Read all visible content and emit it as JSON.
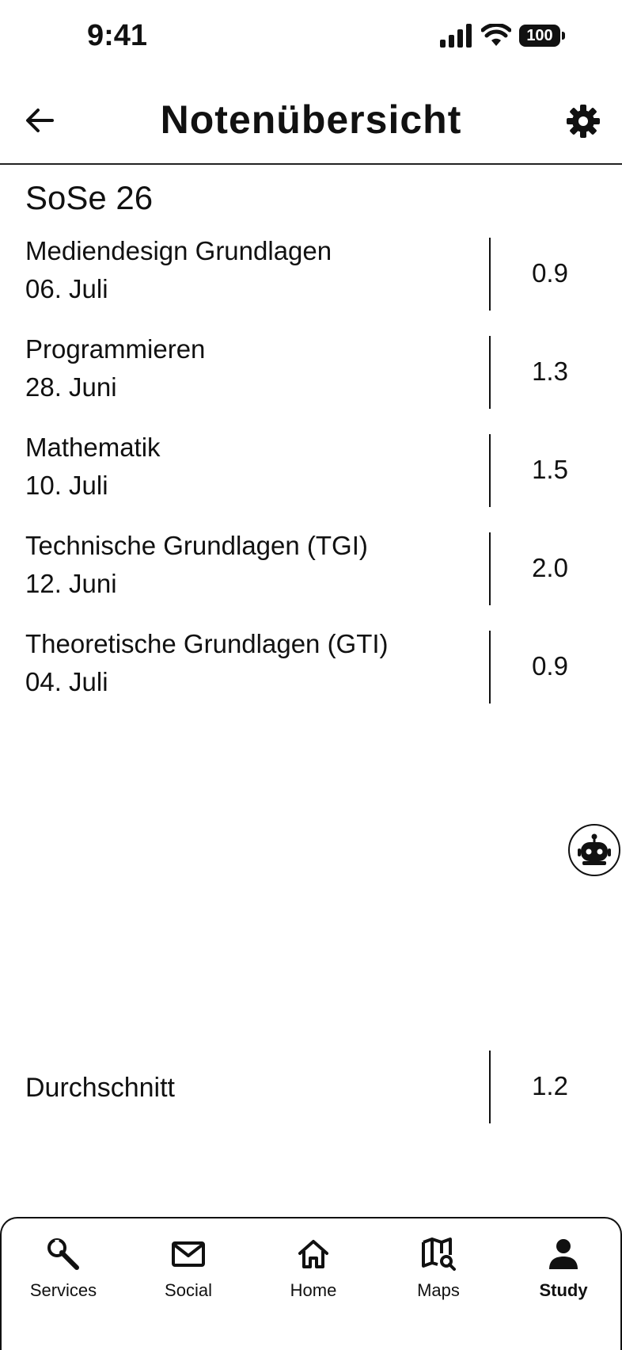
{
  "status_bar": {
    "time": "9:41",
    "battery": "100"
  },
  "header": {
    "title": "Notenübersicht"
  },
  "semester": "SoSe 26",
  "courses": [
    {
      "name": "Mediendesign Grundlagen",
      "date": "06. Juli",
      "grade": "0.9"
    },
    {
      "name": "Programmieren",
      "date": "28. Juni",
      "grade": "1.3"
    },
    {
      "name": "Mathematik",
      "date": "10. Juli",
      "grade": "1.5"
    },
    {
      "name": "Technische Grundlagen (TGI)",
      "date": "12. Juni",
      "grade": "2.0"
    },
    {
      "name": "Theoretische Grundlagen (GTI)",
      "date": "04. Juli",
      "grade": "0.9"
    }
  ],
  "average": {
    "label": "Durchschnitt",
    "value": "1.2"
  },
  "tabs": [
    {
      "label": "Services",
      "icon": "wrench-icon"
    },
    {
      "label": "Social",
      "icon": "mail-icon"
    },
    {
      "label": "Home",
      "icon": "home-icon"
    },
    {
      "label": "Maps",
      "icon": "map-search-icon"
    },
    {
      "label": "Study",
      "icon": "person-icon",
      "active": true
    }
  ]
}
